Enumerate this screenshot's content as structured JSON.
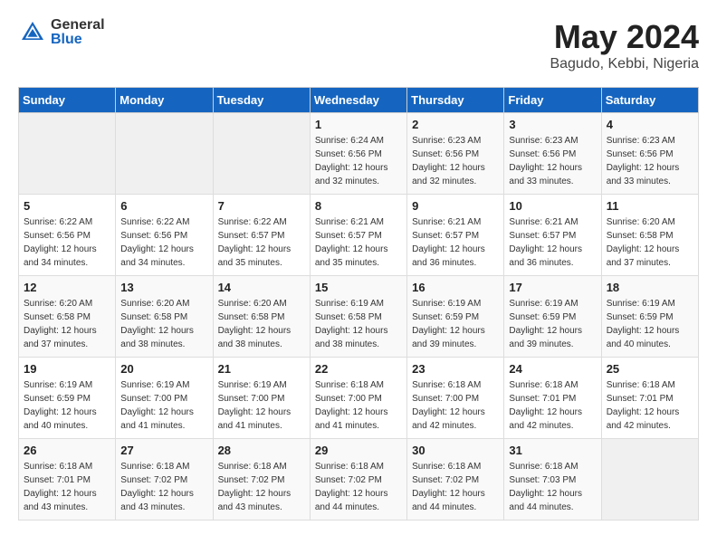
{
  "header": {
    "logo_general": "General",
    "logo_blue": "Blue",
    "month": "May 2024",
    "location": "Bagudo, Kebbi, Nigeria"
  },
  "weekdays": [
    "Sunday",
    "Monday",
    "Tuesday",
    "Wednesday",
    "Thursday",
    "Friday",
    "Saturday"
  ],
  "weeks": [
    [
      {
        "day": "",
        "info": ""
      },
      {
        "day": "",
        "info": ""
      },
      {
        "day": "",
        "info": ""
      },
      {
        "day": "1",
        "info": "Sunrise: 6:24 AM\nSunset: 6:56 PM\nDaylight: 12 hours\nand 32 minutes."
      },
      {
        "day": "2",
        "info": "Sunrise: 6:23 AM\nSunset: 6:56 PM\nDaylight: 12 hours\nand 32 minutes."
      },
      {
        "day": "3",
        "info": "Sunrise: 6:23 AM\nSunset: 6:56 PM\nDaylight: 12 hours\nand 33 minutes."
      },
      {
        "day": "4",
        "info": "Sunrise: 6:23 AM\nSunset: 6:56 PM\nDaylight: 12 hours\nand 33 minutes."
      }
    ],
    [
      {
        "day": "5",
        "info": "Sunrise: 6:22 AM\nSunset: 6:56 PM\nDaylight: 12 hours\nand 34 minutes."
      },
      {
        "day": "6",
        "info": "Sunrise: 6:22 AM\nSunset: 6:56 PM\nDaylight: 12 hours\nand 34 minutes."
      },
      {
        "day": "7",
        "info": "Sunrise: 6:22 AM\nSunset: 6:57 PM\nDaylight: 12 hours\nand 35 minutes."
      },
      {
        "day": "8",
        "info": "Sunrise: 6:21 AM\nSunset: 6:57 PM\nDaylight: 12 hours\nand 35 minutes."
      },
      {
        "day": "9",
        "info": "Sunrise: 6:21 AM\nSunset: 6:57 PM\nDaylight: 12 hours\nand 36 minutes."
      },
      {
        "day": "10",
        "info": "Sunrise: 6:21 AM\nSunset: 6:57 PM\nDaylight: 12 hours\nand 36 minutes."
      },
      {
        "day": "11",
        "info": "Sunrise: 6:20 AM\nSunset: 6:58 PM\nDaylight: 12 hours\nand 37 minutes."
      }
    ],
    [
      {
        "day": "12",
        "info": "Sunrise: 6:20 AM\nSunset: 6:58 PM\nDaylight: 12 hours\nand 37 minutes."
      },
      {
        "day": "13",
        "info": "Sunrise: 6:20 AM\nSunset: 6:58 PM\nDaylight: 12 hours\nand 38 minutes."
      },
      {
        "day": "14",
        "info": "Sunrise: 6:20 AM\nSunset: 6:58 PM\nDaylight: 12 hours\nand 38 minutes."
      },
      {
        "day": "15",
        "info": "Sunrise: 6:19 AM\nSunset: 6:58 PM\nDaylight: 12 hours\nand 38 minutes."
      },
      {
        "day": "16",
        "info": "Sunrise: 6:19 AM\nSunset: 6:59 PM\nDaylight: 12 hours\nand 39 minutes."
      },
      {
        "day": "17",
        "info": "Sunrise: 6:19 AM\nSunset: 6:59 PM\nDaylight: 12 hours\nand 39 minutes."
      },
      {
        "day": "18",
        "info": "Sunrise: 6:19 AM\nSunset: 6:59 PM\nDaylight: 12 hours\nand 40 minutes."
      }
    ],
    [
      {
        "day": "19",
        "info": "Sunrise: 6:19 AM\nSunset: 6:59 PM\nDaylight: 12 hours\nand 40 minutes."
      },
      {
        "day": "20",
        "info": "Sunrise: 6:19 AM\nSunset: 7:00 PM\nDaylight: 12 hours\nand 41 minutes."
      },
      {
        "day": "21",
        "info": "Sunrise: 6:19 AM\nSunset: 7:00 PM\nDaylight: 12 hours\nand 41 minutes."
      },
      {
        "day": "22",
        "info": "Sunrise: 6:18 AM\nSunset: 7:00 PM\nDaylight: 12 hours\nand 41 minutes."
      },
      {
        "day": "23",
        "info": "Sunrise: 6:18 AM\nSunset: 7:00 PM\nDaylight: 12 hours\nand 42 minutes."
      },
      {
        "day": "24",
        "info": "Sunrise: 6:18 AM\nSunset: 7:01 PM\nDaylight: 12 hours\nand 42 minutes."
      },
      {
        "day": "25",
        "info": "Sunrise: 6:18 AM\nSunset: 7:01 PM\nDaylight: 12 hours\nand 42 minutes."
      }
    ],
    [
      {
        "day": "26",
        "info": "Sunrise: 6:18 AM\nSunset: 7:01 PM\nDaylight: 12 hours\nand 43 minutes."
      },
      {
        "day": "27",
        "info": "Sunrise: 6:18 AM\nSunset: 7:02 PM\nDaylight: 12 hours\nand 43 minutes."
      },
      {
        "day": "28",
        "info": "Sunrise: 6:18 AM\nSunset: 7:02 PM\nDaylight: 12 hours\nand 43 minutes."
      },
      {
        "day": "29",
        "info": "Sunrise: 6:18 AM\nSunset: 7:02 PM\nDaylight: 12 hours\nand 44 minutes."
      },
      {
        "day": "30",
        "info": "Sunrise: 6:18 AM\nSunset: 7:02 PM\nDaylight: 12 hours\nand 44 minutes."
      },
      {
        "day": "31",
        "info": "Sunrise: 6:18 AM\nSunset: 7:03 PM\nDaylight: 12 hours\nand 44 minutes."
      },
      {
        "day": "",
        "info": ""
      }
    ]
  ]
}
